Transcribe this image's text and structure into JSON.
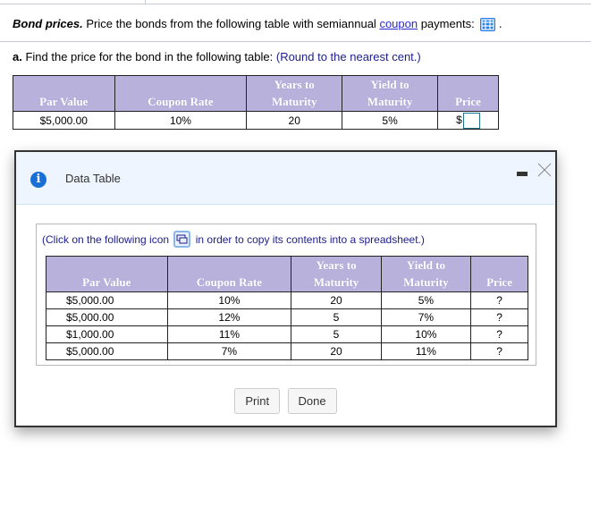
{
  "question": {
    "title": "Bond prices.",
    "text_before_link": " Price the bonds from the following table with semiannual ",
    "link": "coupon",
    "text_after_link": " payments: ",
    "after_icon": " .",
    "icon": "data-table-icon"
  },
  "part_a": {
    "label": "a.",
    "text": " Find the price for the bond in the following table:  ",
    "hint": "(Round to the nearest cent.)"
  },
  "answer_table": {
    "headers": [
      {
        "line1": "",
        "line2": "Par Value"
      },
      {
        "line1": "",
        "line2": "Coupon Rate"
      },
      {
        "line1": "Years to",
        "line2": "Maturity"
      },
      {
        "line1": "Yield to",
        "line2": "Maturity"
      },
      {
        "line1": "",
        "line2": "Price"
      }
    ],
    "row": {
      "par_value": "$5,000.00",
      "coupon_rate": "10%",
      "years": "20",
      "yield": "5%",
      "price_prefix": "$",
      "price_value": ""
    }
  },
  "modal": {
    "title": "Data Table",
    "instruction_before": "(Click on the following icon ",
    "instruction_after": " in order to copy its contents into a spreadsheet.)",
    "headers": [
      {
        "line1": "",
        "line2": "Par Value"
      },
      {
        "line1": "",
        "line2": "Coupon Rate"
      },
      {
        "line1": "Years to",
        "line2": "Maturity"
      },
      {
        "line1": "Yield to",
        "line2": "Maturity"
      },
      {
        "line1": "",
        "line2": "Price"
      }
    ],
    "rows": [
      [
        "$5,000.00",
        "10%",
        "20",
        "5%",
        "?"
      ],
      [
        "$5,000.00",
        "12%",
        "5",
        "7%",
        "?"
      ],
      [
        "$1,000.00",
        "11%",
        "5",
        "10%",
        "?"
      ],
      [
        "$5,000.00",
        "7%",
        "20",
        "11%",
        "?"
      ]
    ],
    "buttons": {
      "print": "Print",
      "done": "Done"
    }
  }
}
